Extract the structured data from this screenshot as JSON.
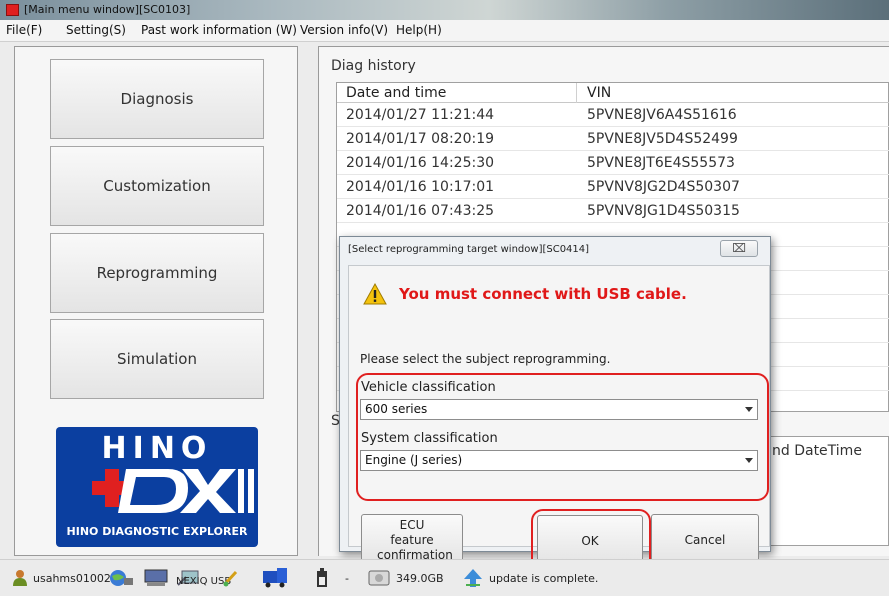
{
  "window": {
    "title": "[Main menu window][SC0103]"
  },
  "menu": {
    "file": "File(F)",
    "setting": "Setting(S)",
    "past_work": "Past work information (W)",
    "version": "Version info(V)",
    "help": "Help(H)"
  },
  "sidebar": {
    "diagnosis": "Diagnosis",
    "customization": "Customization",
    "reprogramming": "Reprogramming",
    "simulation": "Simulation"
  },
  "logo": {
    "brand": "HINO",
    "sub": "HINO DIAGNOSTIC EXPLORER"
  },
  "diag_history": {
    "label": "Diag history",
    "headers": [
      "Date and time",
      "VIN"
    ],
    "rows": [
      [
        "2014/01/27 11:21:44",
        "5PVNE8JV6A4S51616"
      ],
      [
        "2014/01/17 08:20:19",
        "5PVNE8JV5D4S52499"
      ],
      [
        "2014/01/16 14:25:30",
        "5PVNE8JT6E4S55573"
      ],
      [
        "2014/01/16 10:17:01",
        "5PVNV8JG2D4S50307"
      ],
      [
        "2014/01/16 07:43:25",
        "5PVNV8JG1D4S50315"
      ]
    ]
  },
  "lower_section": {
    "label_fragment": "S",
    "header_fragment": "nd DateTime"
  },
  "dialog": {
    "title": "[Select reprogramming target window][SC0414]",
    "close": "⌧",
    "warning": "You must connect with USB cable.",
    "prompt": "Please select the subject reprogramming.",
    "vehicle_label": "Vehicle classification",
    "vehicle_value": "600 series",
    "system_label": "System classification",
    "system_value": "Engine (J series)",
    "ecu_button": "ECU feature confirmation",
    "ok_button": "OK",
    "cancel_button": "Cancel"
  },
  "status": {
    "user": "usahms010022",
    "interface": "NEXIQ USB",
    "dash": "-",
    "disk": "349.0GB",
    "update": "update is complete."
  },
  "colors": {
    "highlight_red": "#e02020",
    "logo_blue": "#0b3fa0",
    "warning_red": "#e01818"
  }
}
